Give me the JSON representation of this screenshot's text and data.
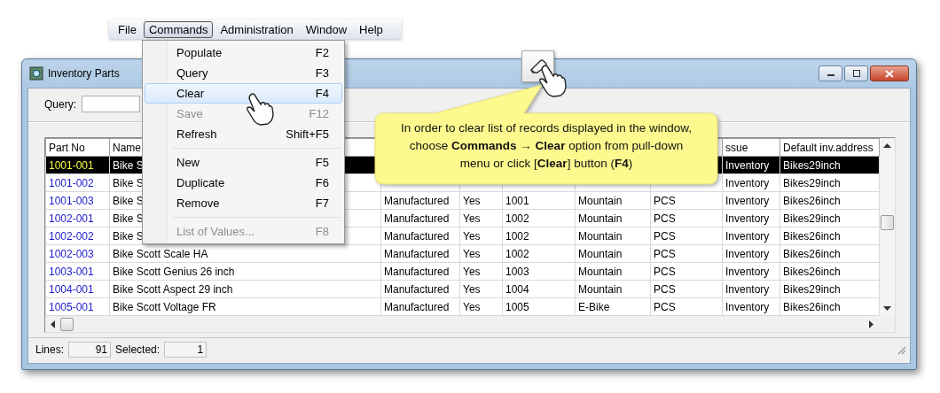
{
  "menu_bar": [
    {
      "label": "File",
      "selected": false
    },
    {
      "label": "Commands",
      "selected": true
    },
    {
      "label": "Administration",
      "selected": false
    },
    {
      "label": "Window",
      "selected": false
    },
    {
      "label": "Help",
      "selected": false
    }
  ],
  "commands_menu": [
    {
      "kind": "item",
      "label": "Populate",
      "shortcut": "F2",
      "selected": false,
      "disabled": false
    },
    {
      "kind": "item",
      "label": "Query",
      "shortcut": "F3",
      "selected": false,
      "disabled": false
    },
    {
      "kind": "item",
      "label": "Clear",
      "shortcut": "F4",
      "selected": true,
      "disabled": false
    },
    {
      "kind": "item",
      "label": "Save",
      "shortcut": "F12",
      "selected": false,
      "disabled": true
    },
    {
      "kind": "item",
      "label": "Refresh",
      "shortcut": "Shift+F5",
      "selected": false,
      "disabled": false
    },
    {
      "kind": "separator"
    },
    {
      "kind": "item",
      "label": "New",
      "shortcut": "F5",
      "selected": false,
      "disabled": false
    },
    {
      "kind": "item",
      "label": "Duplicate",
      "shortcut": "F6",
      "selected": false,
      "disabled": false
    },
    {
      "kind": "item",
      "label": "Remove",
      "shortcut": "F7",
      "selected": false,
      "disabled": false
    },
    {
      "kind": "separator"
    },
    {
      "kind": "item",
      "label": "List of Values...",
      "shortcut": "F8",
      "selected": false,
      "disabled": true
    }
  ],
  "window": {
    "title": "Inventory Parts"
  },
  "query": {
    "label": "Query:"
  },
  "table": {
    "columns": [
      "Part No",
      "Name",
      null,
      null,
      null,
      null,
      null,
      "ssue",
      "Default inv.address"
    ],
    "rows": [
      {
        "selected": true,
        "cells": [
          "1001-001",
          "Bike S",
          null,
          null,
          null,
          null,
          null,
          "Inventory",
          "Bikes29inch"
        ]
      },
      {
        "selected": false,
        "cells": [
          "1001-002",
          "Bike S",
          null,
          null,
          null,
          null,
          null,
          "Inventory",
          "Bikes29inch"
        ]
      },
      {
        "selected": false,
        "cells": [
          "1001-003",
          "Bike S",
          "Manufactured",
          "Yes",
          "1001",
          "Mountain",
          "PCS",
          "Inventory",
          "Bikes26inch"
        ]
      },
      {
        "selected": false,
        "cells": [
          "1002-001",
          "Bike S",
          "Manufactured",
          "Yes",
          "1002",
          "Mountain",
          "PCS",
          "Inventory",
          "Bikes29inch"
        ]
      },
      {
        "selected": false,
        "cells": [
          "1002-002",
          "Bike S",
          "Manufactured",
          "Yes",
          "1002",
          "Mountain",
          "PCS",
          "Inventory",
          "Bikes26inch"
        ]
      },
      {
        "selected": false,
        "cells": [
          "1002-003",
          "Bike Scott Scale HA",
          "Manufactured",
          "Yes",
          "1002",
          "Mountain",
          "PCS",
          "Inventory",
          "Bikes26inch"
        ]
      },
      {
        "selected": false,
        "cells": [
          "1003-001",
          "Bike Scott Genius 26 inch",
          "Manufactured",
          "Yes",
          "1003",
          "Mountain",
          "PCS",
          "Inventory",
          "Bikes26inch"
        ]
      },
      {
        "selected": false,
        "cells": [
          "1004-001",
          "Bike Scott Aspect 29 inch",
          "Manufactured",
          "Yes",
          "1004",
          "Mountain",
          "PCS",
          "Inventory",
          "Bikes29inch"
        ]
      },
      {
        "selected": false,
        "cells": [
          "1005-001",
          "Bike Scott Voltage FR",
          "Manufactured",
          "Yes",
          "1005",
          "E-Bike",
          "PCS",
          "Inventory",
          "Bikes26inch"
        ]
      }
    ]
  },
  "status": {
    "lines_label": "Lines:",
    "lines": "91",
    "selected_label": "Selected:",
    "selected": "1"
  },
  "callout": {
    "text": "In order to clear list of records displayed in the window, choose **Commands** → **Clear** option from pull-down menu or click [**Clear**] button (**F4**)"
  }
}
